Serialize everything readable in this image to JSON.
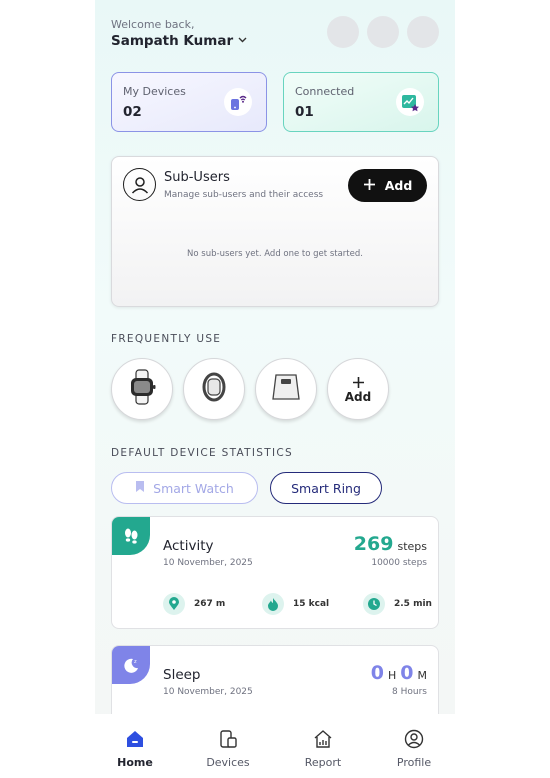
{
  "header": {
    "welcome": "Welcome back,",
    "user_name": "Sampath Kumar"
  },
  "stats": {
    "devices": {
      "label": "My Devices",
      "value": "02"
    },
    "connected": {
      "label": "Connected",
      "value": "01"
    }
  },
  "sub_users": {
    "title": "Sub-Users",
    "subtitle": "Manage sub-users and their access",
    "add_label": "Add",
    "empty_text": "No sub-users yet. Add one to get started."
  },
  "frequently_use": {
    "title": "FREQUENTLY USE",
    "items": [
      "smart-watch-icon",
      "smart-band-icon",
      "smart-scale-icon"
    ],
    "add_label": "Add"
  },
  "default_stats": {
    "title": "DEFAULT DEVICE STATISTICS",
    "tabs": [
      {
        "label": "Smart Watch",
        "active": false
      },
      {
        "label": "Smart Ring",
        "active": true
      }
    ]
  },
  "activity": {
    "title": "Activity",
    "date": "10 November, 2025",
    "value": "269",
    "unit": "steps",
    "goal": "10000 steps",
    "distance": "267 m",
    "calories": "15 kcal",
    "duration": "2.5 min"
  },
  "sleep": {
    "title": "Sleep",
    "date": "10 November, 2025",
    "hours_value": "0",
    "hours_unit": "H",
    "minutes_value": "0",
    "minutes_unit": "M",
    "goal": "8 Hours"
  },
  "nav": {
    "items": [
      {
        "label": "Home",
        "icon": "home-icon",
        "active": true
      },
      {
        "label": "Devices",
        "icon": "devices-icon",
        "active": false
      },
      {
        "label": "Report",
        "icon": "report-icon",
        "active": false
      },
      {
        "label": "Profile",
        "icon": "profile-icon",
        "active": false
      }
    ]
  },
  "colors": {
    "accent_teal": "#23a88f",
    "accent_indigo": "#252b7a",
    "sleep_purple": "#7f84e8"
  }
}
